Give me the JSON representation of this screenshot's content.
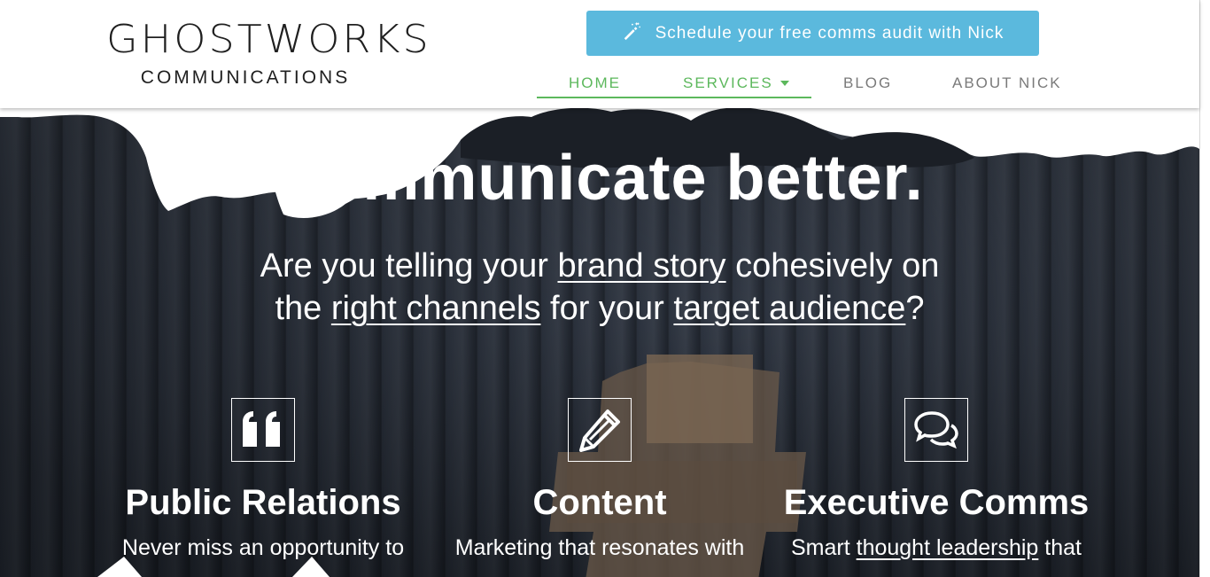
{
  "header": {
    "logo": {
      "wordmark": "GHOSTWORKS",
      "subtitle": "COMMUNICATIONS"
    },
    "cta": {
      "icon": "magic-wand-icon",
      "label": "Schedule your free comms audit with Nick"
    },
    "nav": [
      {
        "label": "HOME",
        "active": true
      },
      {
        "label": "SERVICES",
        "active": true,
        "has_dropdown": true
      },
      {
        "label": "BLOG",
        "active": false
      },
      {
        "label": "ABOUT NICK",
        "active": false
      }
    ]
  },
  "hero": {
    "headline": "Communicate better.",
    "subline": {
      "part1": "Are you telling your ",
      "link1": "brand story",
      "part2": " cohesively on",
      "part3": "the ",
      "link2": "right channels",
      "part4": " for your ",
      "link3": "target audience",
      "part5": "?"
    }
  },
  "services": [
    {
      "icon": "quote-icon",
      "title": "Public Relations",
      "desc": "Never miss an opportunity to"
    },
    {
      "icon": "pencil-icon",
      "title": "Content",
      "desc": "Marketing that resonates with"
    },
    {
      "icon": "comments-icon",
      "title": "Executive Comms",
      "desc_pre": "Smart ",
      "desc_link": "thought leadership",
      "desc_post": " that"
    }
  ],
  "colors": {
    "accent_green": "#5cb85c",
    "cta_blue": "#5bb9dd",
    "nav_gray": "#7a7a7a",
    "hero_dark": "#2e3541"
  }
}
